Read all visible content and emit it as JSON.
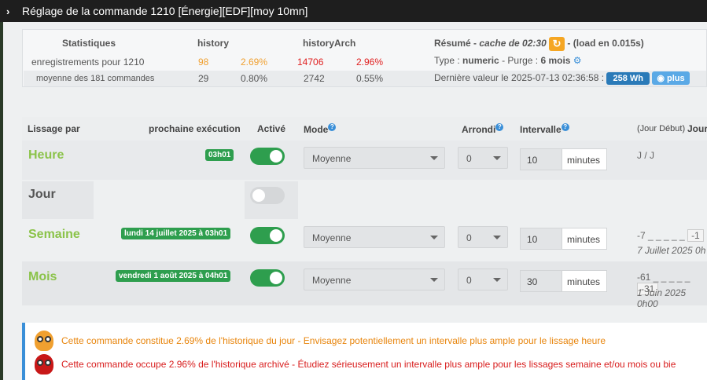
{
  "window": {
    "title": "Réglage de la commande 1210 [Énergie][EDF][moy 10mn]"
  },
  "stats": {
    "col_statistiques": "Statistiques",
    "col_history": "history",
    "col_historyarch": "historyArch",
    "resume_label": "Résumé",
    "resume_cache": "cache de 02:30",
    "resume_load": "(load en 0.015s)",
    "row1": {
      "label": "enregistrements pour 1210",
      "history": "98",
      "history_pct": "2.69%",
      "arch": "14706",
      "arch_pct": "2.96%"
    },
    "row2": {
      "label": "moyenne des 181 commandes",
      "history": "29",
      "history_pct": "0.80%",
      "arch": "2742",
      "arch_pct": "0.55%"
    },
    "type_label": "Type :",
    "type_value": "numeric",
    "purge_label": "- Purge :",
    "purge_value": "6 mois",
    "last_value_label": "Dernière valeur le 2025-07-13 02:36:58 :",
    "last_value_badge": "258 Wh",
    "plus_label": "plus"
  },
  "table": {
    "headers": {
      "lissage": "Lissage par",
      "prochaine": "prochaine exécution",
      "active": "Activé",
      "mode": "Mode",
      "arrondi": "Arrondi",
      "intervalle": "Intervalle",
      "jour_debut": "(Jour Début)",
      "jour": "Jour"
    },
    "rows": [
      {
        "label": "Heure",
        "next": "03h01",
        "active": true,
        "mode": "Moyenne",
        "arrondi": "0",
        "interval": "10",
        "unit": "minutes",
        "jours": "J / J",
        "date": ""
      },
      {
        "label": "Jour",
        "next": "",
        "active": false,
        "mode": "",
        "arrondi": "",
        "interval": "",
        "unit": "",
        "jours": "",
        "date": ""
      },
      {
        "label": "Semaine",
        "next": "lundi 14 juillet 2025 à 03h01",
        "active": true,
        "mode": "Moyenne",
        "arrondi": "0",
        "interval": "10",
        "unit": "minutes",
        "jours": "-7 _ _ _ _ _",
        "jours_end": "-1",
        "date": "7 Juillet 2025 0h"
      },
      {
        "label": "Mois",
        "next": "vendredi 1 août 2025 à 04h01",
        "active": true,
        "mode": "Moyenne",
        "arrondi": "0",
        "interval": "30",
        "unit": "minutes",
        "jours": "-61 _ _ _ _ _",
        "jours_end": "-31",
        "date": "1 Juin 2025 0h00"
      }
    ]
  },
  "alerts": [
    {
      "text": "Cette commande constitue 2.69% de l'historique du jour - Envisagez potentiellement un intervalle plus ample pour le lissage heure",
      "color": "#e8850c",
      "icon": "owl-orange-icon"
    },
    {
      "text": "Cette commande occupe 2.96% de l'historique archivé - Étudiez sérieusement un intervalle plus ample pour les lissages semaine et/ou mois ou bie",
      "color": "#d81c1c",
      "icon": "owl-red-icon"
    }
  ]
}
